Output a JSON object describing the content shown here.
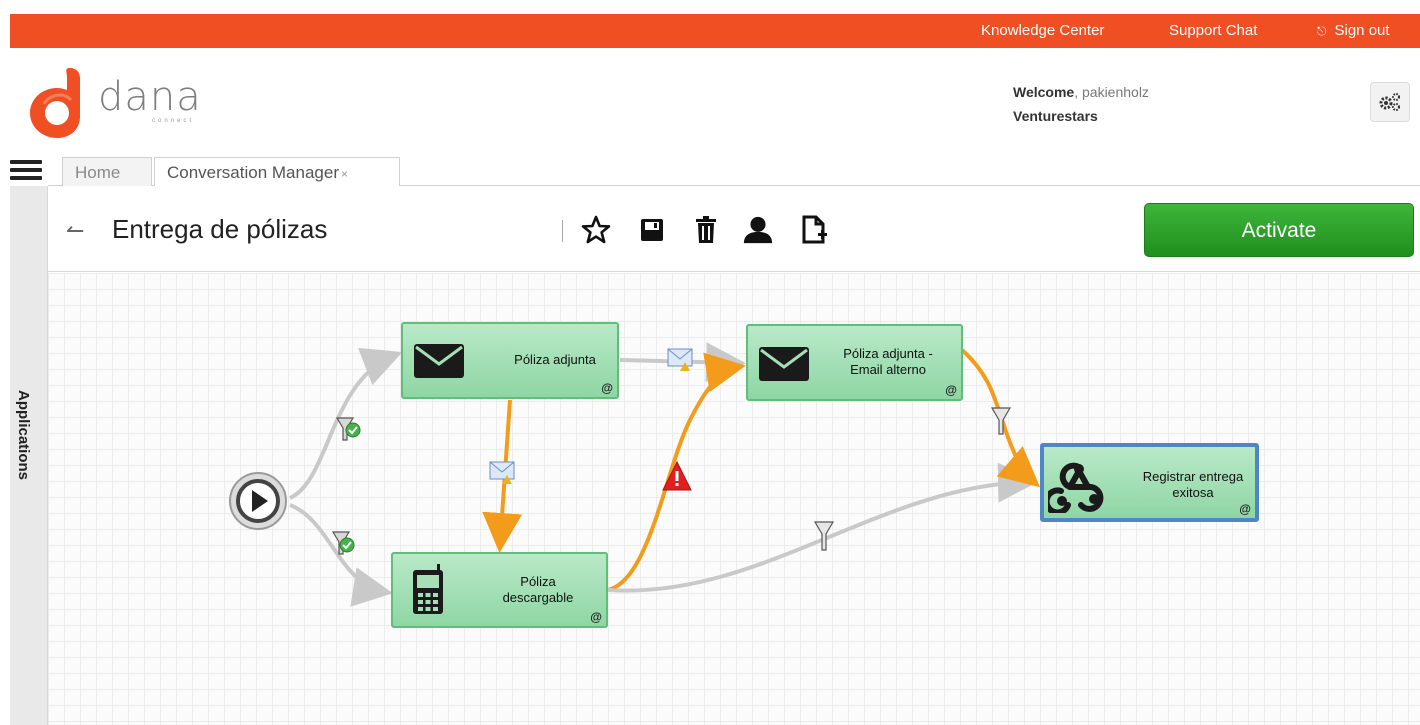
{
  "topnav": {
    "knowledge_center": "Knowledge Center",
    "support_chat": "Support Chat",
    "sign_out": "Sign out",
    "color": "#f04e23"
  },
  "brand": {
    "name": "dana",
    "subtitle": "connect",
    "logo_color": "#f04e23"
  },
  "header": {
    "welcome_label": "Welcome",
    "username": ", pakienholz",
    "company": "Venturestars",
    "settings_icon": "gears-icon"
  },
  "sidebar": {
    "label": "Applications",
    "menu_icon": "hamburger-icon"
  },
  "tabs": [
    {
      "label": "Home"
    },
    {
      "label": "Conversation Manager",
      "close": "×"
    }
  ],
  "toolbar": {
    "back_icon": "back-arrow-icon",
    "title": "Entrega de pólizas",
    "icons": [
      "star-icon",
      "save-icon",
      "trash-icon",
      "user-icon",
      "new-document-icon"
    ],
    "activate_label": "Activate",
    "activate_color": "#2aa128"
  },
  "flow": {
    "start_icon": "play-icon",
    "nodes": [
      {
        "id": "n1",
        "type": "email",
        "icon": "envelope-icon",
        "label": "Póliza adjunta"
      },
      {
        "id": "n2",
        "type": "sms",
        "icon": "mobile-phone-icon",
        "label_line1": "Póliza",
        "label_line2": "descargable"
      },
      {
        "id": "n3",
        "type": "email",
        "icon": "envelope-icon",
        "label_line1": "Póliza adjunta -",
        "label_line2": "Email alterno"
      },
      {
        "id": "n4",
        "type": "webhook",
        "icon": "webhook-icon",
        "label_line1": "Registrar entrega",
        "label_line2": "exitosa",
        "selected": true
      }
    ],
    "attachment_icon": "paperclip-icon",
    "connector_icons": [
      "filter-check-icon",
      "email-warning-icon",
      "warning-triangle-icon",
      "filter-icon"
    ],
    "colors": {
      "default": "#c9c9c9",
      "fallback": "#f39c1b",
      "node_fill": "#a6dfb6",
      "node_border": "#5fbf7a",
      "selected_border": "#4f86c6"
    }
  }
}
